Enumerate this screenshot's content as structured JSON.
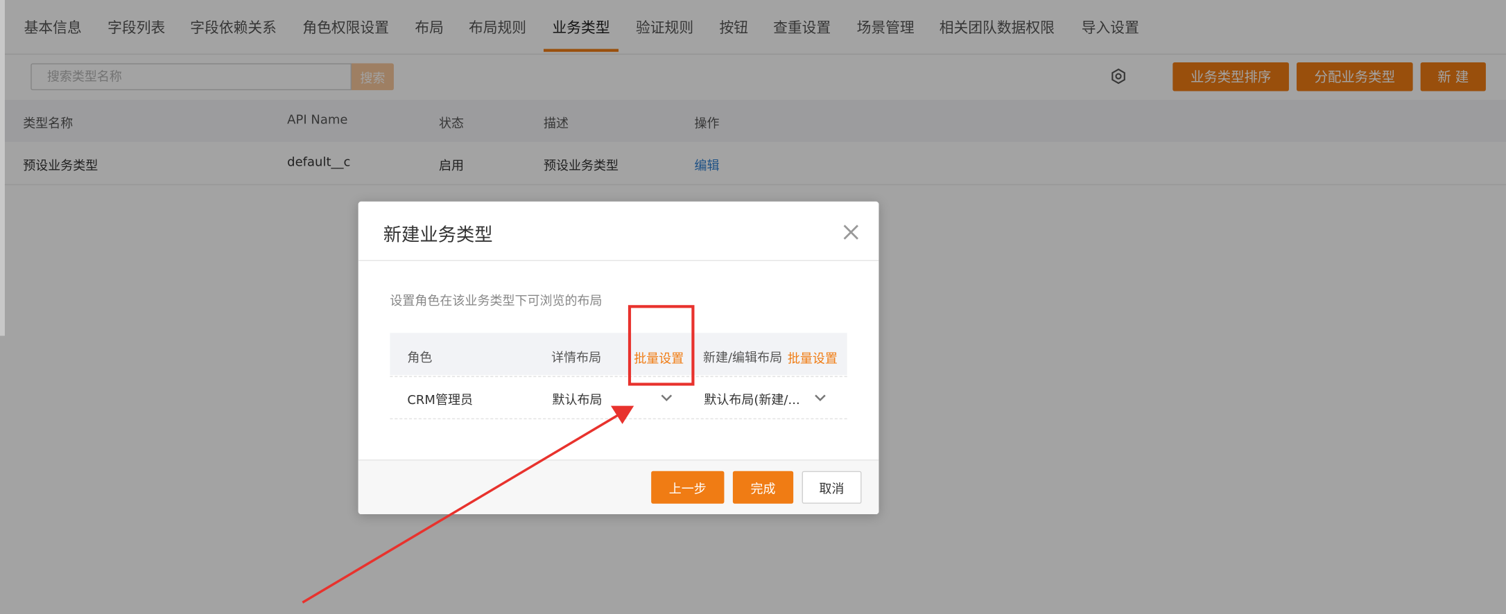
{
  "tabs": [
    {
      "label": "基本信息"
    },
    {
      "label": "字段列表"
    },
    {
      "label": "字段依赖关系"
    },
    {
      "label": "角色权限设置"
    },
    {
      "label": "布局"
    },
    {
      "label": "布局规则"
    },
    {
      "label": "业务类型"
    },
    {
      "label": "验证规则"
    },
    {
      "label": "按钮"
    },
    {
      "label": "查重设置"
    },
    {
      "label": "场景管理"
    },
    {
      "label": "相关团队数据权限"
    },
    {
      "label": "导入设置"
    }
  ],
  "active_tab": "业务类型",
  "toolbar": {
    "search_placeholder": "搜索类型名称",
    "search_label": "搜索",
    "settings_icon": "gear-icon",
    "buttons": {
      "sort": "业务类型排序",
      "assign": "分配业务类型",
      "new": "新 建"
    }
  },
  "table": {
    "headers": [
      "类型名称",
      "API Name",
      "状态",
      "描述",
      "操作"
    ],
    "rows": [
      {
        "name": "预设业务类型",
        "api_name": "default__c",
        "status": "启用",
        "description": "预设业务类型",
        "action": "编辑"
      }
    ]
  },
  "modal": {
    "title": "新建业务类型",
    "close_icon": "close-icon",
    "description": "设置角色在该业务类型下可浏览的布局",
    "headers": {
      "role": "角色",
      "detail_layout": "详情布局",
      "batch_1": "批量设置",
      "edit_layout": "新建/编辑布局",
      "batch_2": "批量设置"
    },
    "rows": [
      {
        "role": "CRM管理员",
        "detail_layout": "默认布局",
        "edit_layout": "默认布局(新建/..."
      }
    ],
    "footer": {
      "prev": "上一步",
      "finish": "完成",
      "cancel": "取消"
    }
  },
  "colors": {
    "accent": "#f07c14",
    "link": "#2f7fd1",
    "annotation": "#e8322d"
  }
}
